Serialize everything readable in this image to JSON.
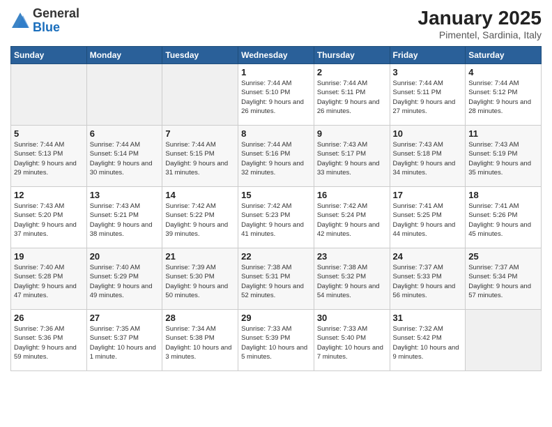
{
  "logo": {
    "general": "General",
    "blue": "Blue"
  },
  "header": {
    "month": "January 2025",
    "location": "Pimentel, Sardinia, Italy"
  },
  "weekdays": [
    "Sunday",
    "Monday",
    "Tuesday",
    "Wednesday",
    "Thursday",
    "Friday",
    "Saturday"
  ],
  "weeks": [
    [
      null,
      null,
      null,
      {
        "day": "1",
        "sunrise": "7:44 AM",
        "sunset": "5:10 PM",
        "daylight": "9 hours and 26 minutes."
      },
      {
        "day": "2",
        "sunrise": "7:44 AM",
        "sunset": "5:11 PM",
        "daylight": "9 hours and 26 minutes."
      },
      {
        "day": "3",
        "sunrise": "7:44 AM",
        "sunset": "5:11 PM",
        "daylight": "9 hours and 27 minutes."
      },
      {
        "day": "4",
        "sunrise": "7:44 AM",
        "sunset": "5:12 PM",
        "daylight": "9 hours and 28 minutes."
      }
    ],
    [
      {
        "day": "5",
        "sunrise": "7:44 AM",
        "sunset": "5:13 PM",
        "daylight": "9 hours and 29 minutes."
      },
      {
        "day": "6",
        "sunrise": "7:44 AM",
        "sunset": "5:14 PM",
        "daylight": "9 hours and 30 minutes."
      },
      {
        "day": "7",
        "sunrise": "7:44 AM",
        "sunset": "5:15 PM",
        "daylight": "9 hours and 31 minutes."
      },
      {
        "day": "8",
        "sunrise": "7:44 AM",
        "sunset": "5:16 PM",
        "daylight": "9 hours and 32 minutes."
      },
      {
        "day": "9",
        "sunrise": "7:43 AM",
        "sunset": "5:17 PM",
        "daylight": "9 hours and 33 minutes."
      },
      {
        "day": "10",
        "sunrise": "7:43 AM",
        "sunset": "5:18 PM",
        "daylight": "9 hours and 34 minutes."
      },
      {
        "day": "11",
        "sunrise": "7:43 AM",
        "sunset": "5:19 PM",
        "daylight": "9 hours and 35 minutes."
      }
    ],
    [
      {
        "day": "12",
        "sunrise": "7:43 AM",
        "sunset": "5:20 PM",
        "daylight": "9 hours and 37 minutes."
      },
      {
        "day": "13",
        "sunrise": "7:43 AM",
        "sunset": "5:21 PM",
        "daylight": "9 hours and 38 minutes."
      },
      {
        "day": "14",
        "sunrise": "7:42 AM",
        "sunset": "5:22 PM",
        "daylight": "9 hours and 39 minutes."
      },
      {
        "day": "15",
        "sunrise": "7:42 AM",
        "sunset": "5:23 PM",
        "daylight": "9 hours and 41 minutes."
      },
      {
        "day": "16",
        "sunrise": "7:42 AM",
        "sunset": "5:24 PM",
        "daylight": "9 hours and 42 minutes."
      },
      {
        "day": "17",
        "sunrise": "7:41 AM",
        "sunset": "5:25 PM",
        "daylight": "9 hours and 44 minutes."
      },
      {
        "day": "18",
        "sunrise": "7:41 AM",
        "sunset": "5:26 PM",
        "daylight": "9 hours and 45 minutes."
      }
    ],
    [
      {
        "day": "19",
        "sunrise": "7:40 AM",
        "sunset": "5:28 PM",
        "daylight": "9 hours and 47 minutes."
      },
      {
        "day": "20",
        "sunrise": "7:40 AM",
        "sunset": "5:29 PM",
        "daylight": "9 hours and 49 minutes."
      },
      {
        "day": "21",
        "sunrise": "7:39 AM",
        "sunset": "5:30 PM",
        "daylight": "9 hours and 50 minutes."
      },
      {
        "day": "22",
        "sunrise": "7:38 AM",
        "sunset": "5:31 PM",
        "daylight": "9 hours and 52 minutes."
      },
      {
        "day": "23",
        "sunrise": "7:38 AM",
        "sunset": "5:32 PM",
        "daylight": "9 hours and 54 minutes."
      },
      {
        "day": "24",
        "sunrise": "7:37 AM",
        "sunset": "5:33 PM",
        "daylight": "9 hours and 56 minutes."
      },
      {
        "day": "25",
        "sunrise": "7:37 AM",
        "sunset": "5:34 PM",
        "daylight": "9 hours and 57 minutes."
      }
    ],
    [
      {
        "day": "26",
        "sunrise": "7:36 AM",
        "sunset": "5:36 PM",
        "daylight": "9 hours and 59 minutes."
      },
      {
        "day": "27",
        "sunrise": "7:35 AM",
        "sunset": "5:37 PM",
        "daylight": "10 hours and 1 minute."
      },
      {
        "day": "28",
        "sunrise": "7:34 AM",
        "sunset": "5:38 PM",
        "daylight": "10 hours and 3 minutes."
      },
      {
        "day": "29",
        "sunrise": "7:33 AM",
        "sunset": "5:39 PM",
        "daylight": "10 hours and 5 minutes."
      },
      {
        "day": "30",
        "sunrise": "7:33 AM",
        "sunset": "5:40 PM",
        "daylight": "10 hours and 7 minutes."
      },
      {
        "day": "31",
        "sunrise": "7:32 AM",
        "sunset": "5:42 PM",
        "daylight": "10 hours and 9 minutes."
      },
      null
    ]
  ],
  "labels": {
    "sunrise": "Sunrise:",
    "sunset": "Sunset:",
    "daylight": "Daylight:"
  }
}
